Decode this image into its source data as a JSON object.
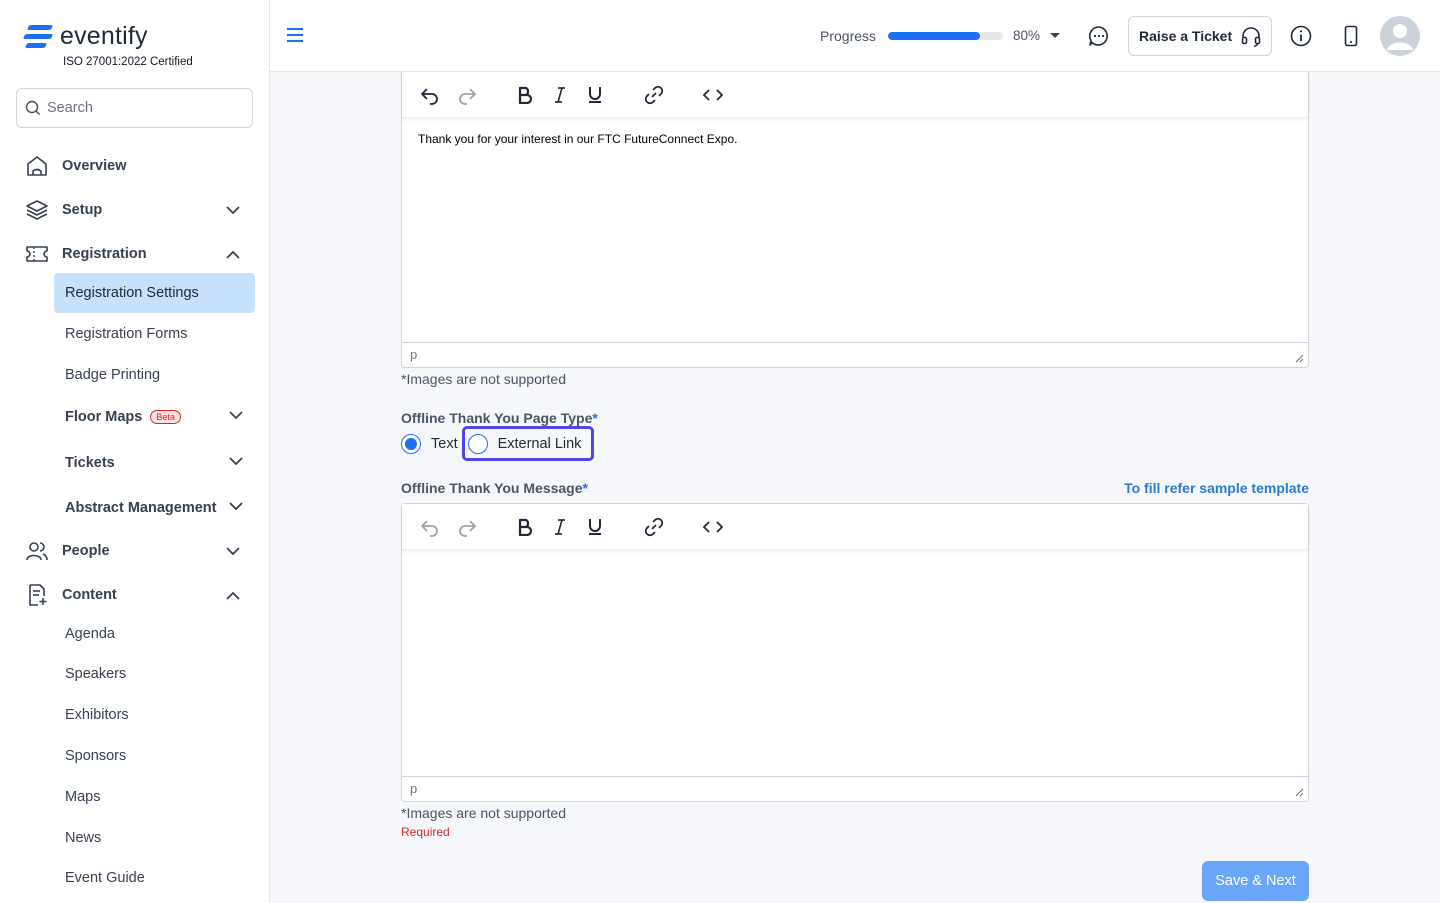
{
  "brand": {
    "name": "eventify",
    "certification": "ISO 27001:2022 Certified"
  },
  "search": {
    "placeholder": "Search"
  },
  "sidebar": {
    "overview": "Overview",
    "setup": "Setup",
    "registration": "Registration",
    "registration_items": [
      "Registration Settings",
      "Registration Forms",
      "Badge Printing",
      "Floor Maps",
      "Tickets",
      "Abstract Management"
    ],
    "beta_badge": "Beta",
    "people": "People",
    "content": "Content",
    "content_items": [
      "Agenda",
      "Speakers",
      "Exhibitors",
      "Sponsors",
      "Maps",
      "News",
      "Event Guide"
    ]
  },
  "topbar": {
    "progress_label": "Progress",
    "progress_value": 80,
    "progress_text": "80%",
    "ticket_label": "Raise a Ticket"
  },
  "editor1": {
    "content": "Thank you for your interest in our FTC FutureConnect Expo.",
    "path": "p",
    "note": "*Images are not supported"
  },
  "page_type": {
    "label": "Offline Thank You Page Type",
    "required_mark": "*",
    "options": [
      "Text",
      "External Link"
    ],
    "selected": "Text"
  },
  "message": {
    "label": "Offline Thank You Message",
    "required_mark": "*",
    "sample_link": "To fill refer sample template",
    "path": "p",
    "note": "*Images are not supported",
    "error": "Required"
  },
  "actions": {
    "save_next": "Save & Next"
  },
  "colors": {
    "accent": "#1d6ff2",
    "active_nav": "#c7e0fb",
    "error": "#dc2626",
    "focus": "#4f46e5"
  }
}
